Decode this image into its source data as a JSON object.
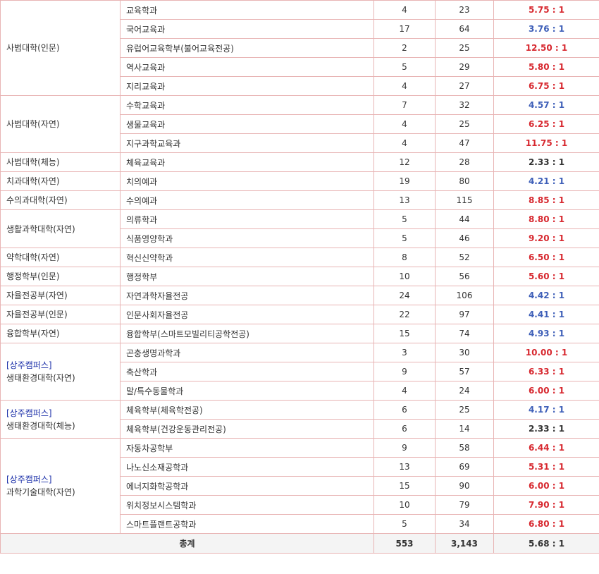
{
  "colors": {
    "high": "#d7282f",
    "mid": "#3e5fb8",
    "low": "#333333",
    "border": "#e8b4b4",
    "total_bg": "#f4f4f4",
    "campus": "#1a2ea8"
  },
  "groups": [
    {
      "college": "사범대학(인문)",
      "rows": [
        {
          "dept": "교육학과",
          "quota": "4",
          "applicants": "23",
          "ratio": "5.75 : 1",
          "tone": "high"
        },
        {
          "dept": "국어교육과",
          "quota": "17",
          "applicants": "64",
          "ratio": "3.76 : 1",
          "tone": "mid"
        },
        {
          "dept": "유럽어교육학부(불어교육전공)",
          "quota": "2",
          "applicants": "25",
          "ratio": "12.50 : 1",
          "tone": "high"
        },
        {
          "dept": "역사교육과",
          "quota": "5",
          "applicants": "29",
          "ratio": "5.80 : 1",
          "tone": "high"
        },
        {
          "dept": "지리교육과",
          "quota": "4",
          "applicants": "27",
          "ratio": "6.75 : 1",
          "tone": "high"
        }
      ]
    },
    {
      "college": "사범대학(자연)",
      "rows": [
        {
          "dept": "수학교육과",
          "quota": "7",
          "applicants": "32",
          "ratio": "4.57 : 1",
          "tone": "mid"
        },
        {
          "dept": "생물교육과",
          "quota": "4",
          "applicants": "25",
          "ratio": "6.25 : 1",
          "tone": "high"
        },
        {
          "dept": "지구과학교육과",
          "quota": "4",
          "applicants": "47",
          "ratio": "11.75 : 1",
          "tone": "high"
        }
      ]
    },
    {
      "college": "사범대학(체능)",
      "rows": [
        {
          "dept": "체육교육과",
          "quota": "12",
          "applicants": "28",
          "ratio": "2.33 : 1",
          "tone": "low"
        }
      ]
    },
    {
      "college": "치과대학(자연)",
      "rows": [
        {
          "dept": "치의예과",
          "quota": "19",
          "applicants": "80",
          "ratio": "4.21 : 1",
          "tone": "mid"
        }
      ]
    },
    {
      "college": "수의과대학(자연)",
      "rows": [
        {
          "dept": "수의예과",
          "quota": "13",
          "applicants": "115",
          "ratio": "8.85 : 1",
          "tone": "high"
        }
      ]
    },
    {
      "college": "생활과학대학(자연)",
      "rows": [
        {
          "dept": "의류학과",
          "quota": "5",
          "applicants": "44",
          "ratio": "8.80 : 1",
          "tone": "high"
        },
        {
          "dept": "식품영양학과",
          "quota": "5",
          "applicants": "46",
          "ratio": "9.20 : 1",
          "tone": "high"
        }
      ]
    },
    {
      "college": "약학대학(자연)",
      "rows": [
        {
          "dept": "혁신신약학과",
          "quota": "8",
          "applicants": "52",
          "ratio": "6.50 : 1",
          "tone": "high"
        }
      ]
    },
    {
      "college": "행정학부(인문)",
      "rows": [
        {
          "dept": "행정학부",
          "quota": "10",
          "applicants": "56",
          "ratio": "5.60 : 1",
          "tone": "high"
        }
      ]
    },
    {
      "college": "자율전공부(자연)",
      "rows": [
        {
          "dept": "자연과학자율전공",
          "quota": "24",
          "applicants": "106",
          "ratio": "4.42 : 1",
          "tone": "mid"
        }
      ]
    },
    {
      "college": "자율전공부(인문)",
      "rows": [
        {
          "dept": "인문사회자율전공",
          "quota": "22",
          "applicants": "97",
          "ratio": "4.41 : 1",
          "tone": "mid"
        }
      ]
    },
    {
      "college": "융합학부(자연)",
      "rows": [
        {
          "dept": "융합학부(스마트모빌리티공학전공)",
          "quota": "15",
          "applicants": "74",
          "ratio": "4.93 : 1",
          "tone": "mid"
        }
      ]
    },
    {
      "campus": "[상주캠퍼스]",
      "college": "생태환경대학(자연)",
      "rows": [
        {
          "dept": "곤충생명과학과",
          "quota": "3",
          "applicants": "30",
          "ratio": "10.00 : 1",
          "tone": "high"
        },
        {
          "dept": "축산학과",
          "quota": "9",
          "applicants": "57",
          "ratio": "6.33 : 1",
          "tone": "high"
        },
        {
          "dept": "말/특수동물학과",
          "quota": "4",
          "applicants": "24",
          "ratio": "6.00 : 1",
          "tone": "high"
        }
      ]
    },
    {
      "campus": "[상주캠퍼스]",
      "college": "생태환경대학(체능)",
      "rows": [
        {
          "dept": "체육학부(체육학전공)",
          "quota": "6",
          "applicants": "25",
          "ratio": "4.17 : 1",
          "tone": "mid"
        },
        {
          "dept": "체육학부(건강운동관리전공)",
          "quota": "6",
          "applicants": "14",
          "ratio": "2.33 : 1",
          "tone": "low"
        }
      ]
    },
    {
      "campus": "[상주캠퍼스]",
      "college": "과학기술대학(자연)",
      "rows": [
        {
          "dept": "자동차공학부",
          "quota": "9",
          "applicants": "58",
          "ratio": "6.44 : 1",
          "tone": "high"
        },
        {
          "dept": "나노신소재공학과",
          "quota": "13",
          "applicants": "69",
          "ratio": "5.31 : 1",
          "tone": "high"
        },
        {
          "dept": "에너지화학공학과",
          "quota": "15",
          "applicants": "90",
          "ratio": "6.00 : 1",
          "tone": "high"
        },
        {
          "dept": "위치정보시스템학과",
          "quota": "10",
          "applicants": "79",
          "ratio": "7.90 : 1",
          "tone": "high"
        },
        {
          "dept": "스마트플랜트공학과",
          "quota": "5",
          "applicants": "34",
          "ratio": "6.80 : 1",
          "tone": "high"
        }
      ]
    }
  ],
  "total": {
    "label": "총계",
    "quota": "553",
    "applicants": "3,143",
    "ratio": "5.68 : 1"
  }
}
